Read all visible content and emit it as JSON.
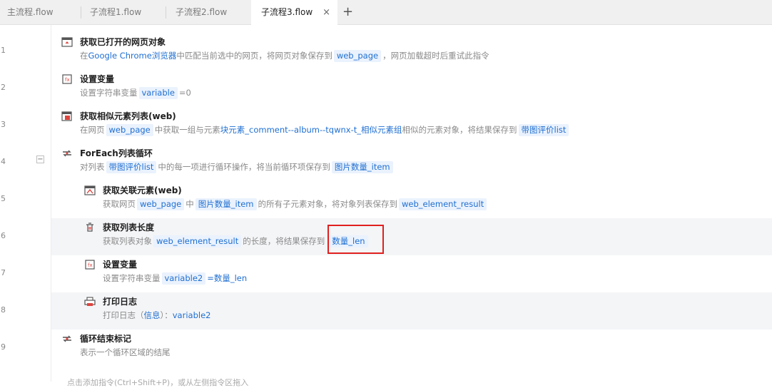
{
  "tabs": [
    {
      "label": "主流程.flow"
    },
    {
      "label": "子流程1.flow"
    },
    {
      "label": "子流程2.flow"
    },
    {
      "label": "子流程3.flow",
      "active": true
    }
  ],
  "tab_close": "×",
  "add_tab": "+",
  "rows": [
    {
      "no": "1",
      "title": "获取已打开的网页对象",
      "icon": "browser-icon",
      "d": [
        "在",
        "Google Chrome浏览器",
        "中匹配当前选中的网页，将网页对象保存到",
        "web_page",
        "，网页加载超时后重试此指令"
      ]
    },
    {
      "no": "2",
      "title": "设置变量",
      "icon": "variable-icon",
      "d": [
        "设置字符串变量",
        "variable",
        "=0"
      ]
    },
    {
      "no": "3",
      "title": "获取相似元素列表(web)",
      "icon": "element-list-icon",
      "d": [
        "在网页",
        "web_page",
        "中获取一组与元素",
        "块元素_comment--album--tqwnx-t_相似元素组",
        "相似的元素对象，将结果保存到",
        "带图评价list"
      ]
    },
    {
      "no": "4",
      "title": "ForEach列表循环",
      "icon": "loop-icon",
      "collapse": "−",
      "d": [
        "对列表",
        "带图评价list",
        "中的每一项进行循环操作，将当前循环项保存到",
        "图片数量_item"
      ]
    },
    {
      "no": "5",
      "title": "获取关联元素(web)",
      "icon": "related-element-icon",
      "d": [
        "获取网页",
        "web_page",
        "中",
        "图片数量_item",
        "的所有子元素对象，将对象列表保存到",
        "web_element_result"
      ]
    },
    {
      "no": "6",
      "title": "获取列表长度",
      "icon": "list-length-icon",
      "d": [
        "获取列表对象",
        "web_element_result",
        "的长度，将结果保存到",
        "数量_len"
      ]
    },
    {
      "no": "7",
      "title": "设置变量",
      "icon": "variable-icon",
      "d": [
        "设置字符串变量",
        "variable2",
        "=数量_len"
      ]
    },
    {
      "no": "8",
      "title": "打印日志",
      "icon": "print-icon",
      "d": [
        "打印日志（",
        "信息",
        "）：",
        "variable2"
      ]
    },
    {
      "no": "9",
      "title": "循环结束标记",
      "icon": "loop-end-icon",
      "d": [
        "表示一个循环区域的结尾"
      ]
    }
  ],
  "footer_hint": "点击添加指令(Ctrl+Shift+P)，或从左侧指令区拖入"
}
